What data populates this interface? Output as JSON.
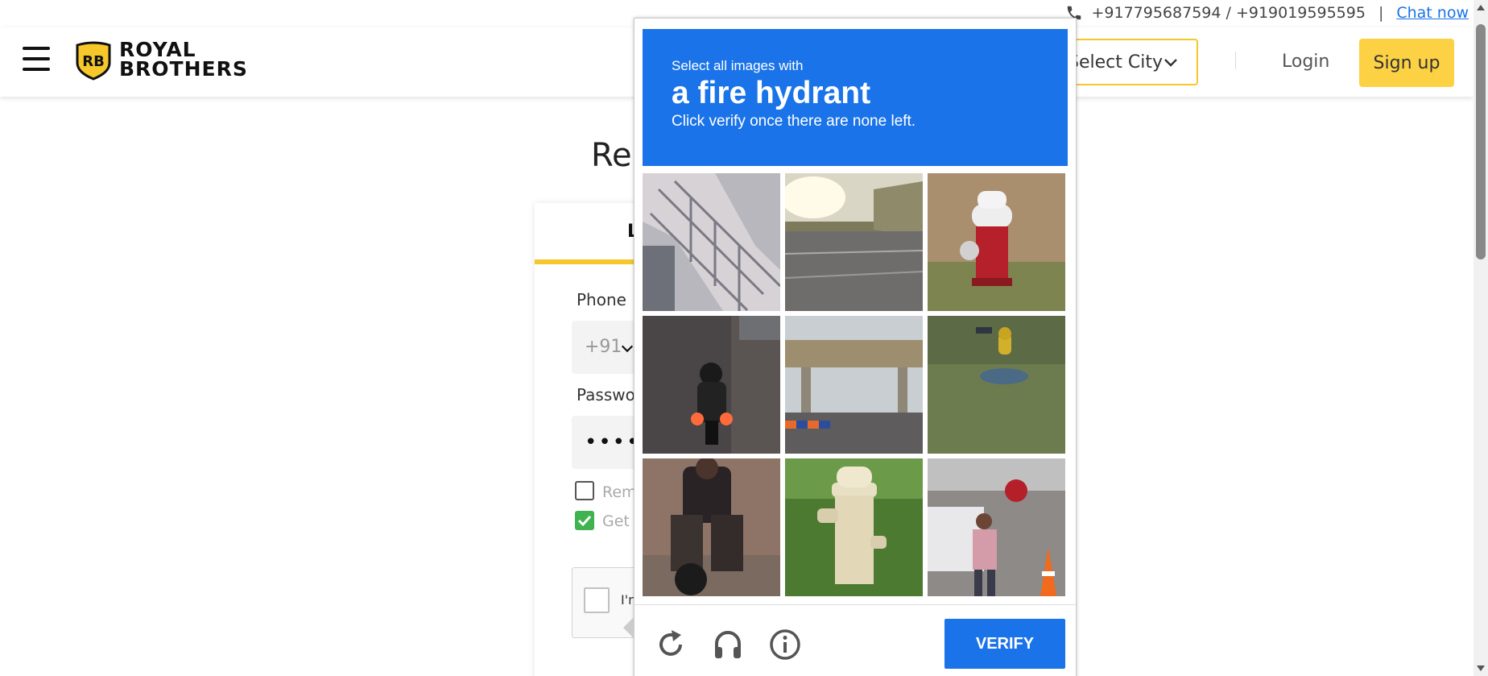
{
  "contact": {
    "phones": "+917795687594 / +919019595595",
    "separator": "|",
    "chat_label": "Chat now"
  },
  "header": {
    "brand_line1": "ROYAL",
    "brand_line2": "BROTHERS",
    "logo_badge": "RB",
    "city_select_value": "Select City",
    "login_label": "Login",
    "signup_label": "Sign up"
  },
  "login_form": {
    "page_title_fragment": "Ren",
    "tab_login": "LOG",
    "phone_label": "Phone",
    "country_code": "+91",
    "password_label": "Passwo",
    "password_value": "•••••",
    "remember_label": "Rem",
    "updates_label": "Get (",
    "updates_checked": true,
    "remember_checked": false,
    "recaptcha_text": "I'n"
  },
  "challenge": {
    "instruction": "Select all images with",
    "target": "a fire hydrant",
    "subinstruction": "Click verify once there are none left.",
    "verify_label": "VERIFY",
    "tiles": [
      {
        "label": "staircase"
      },
      {
        "label": "road"
      },
      {
        "label": "red hydrant"
      },
      {
        "label": "motorcycle"
      },
      {
        "label": "overpass"
      },
      {
        "label": "yellow hydrant"
      },
      {
        "label": "rider"
      },
      {
        "label": "white hydrant"
      },
      {
        "label": "street people"
      }
    ],
    "icons": [
      "reload-icon",
      "audio-icon",
      "info-icon"
    ]
  },
  "colors": {
    "brand_yellow": "#fdd144",
    "challenge_blue": "#1a73e8",
    "check_green": "#3fb34f"
  }
}
